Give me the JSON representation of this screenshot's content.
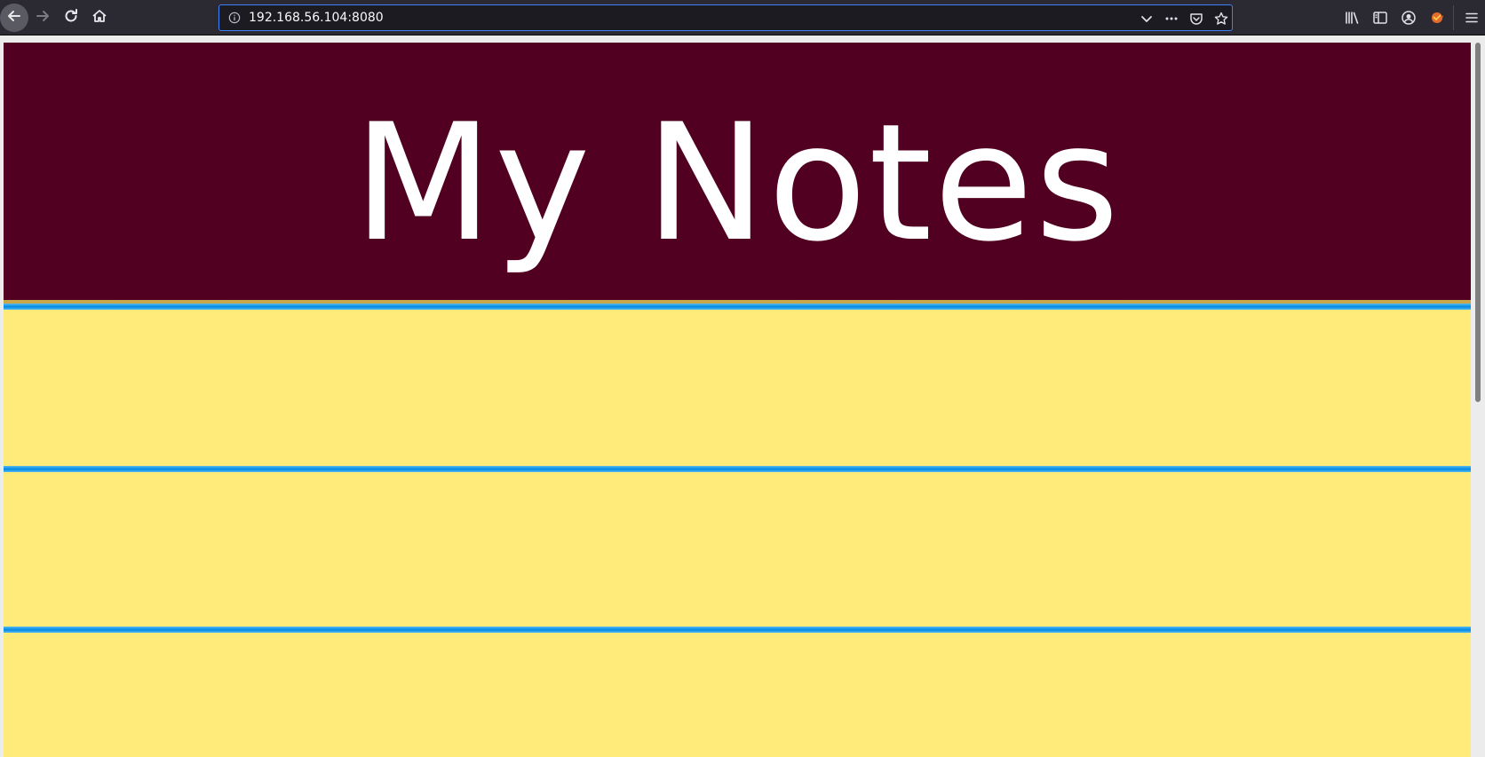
{
  "browser": {
    "url": "192.168.56.104:8080",
    "icons": {
      "back": "back-arrow-icon",
      "forward": "forward-arrow-icon",
      "reload": "reload-icon",
      "home": "home-icon",
      "info": "info-icon",
      "dropdown": "chevron-down-icon",
      "more": "more-icon",
      "pocket": "pocket-icon",
      "star": "star-icon",
      "library": "library-icon",
      "sidebar": "sidebar-icon",
      "account": "account-icon",
      "extension": "extension-icon",
      "menu": "hamburger-menu-icon"
    }
  },
  "page": {
    "title": "My Notes",
    "colors": {
      "header": "#520021",
      "paper": "#ffeb7a",
      "rule": "#0a8fe6",
      "title_text": "#ffffff"
    }
  }
}
